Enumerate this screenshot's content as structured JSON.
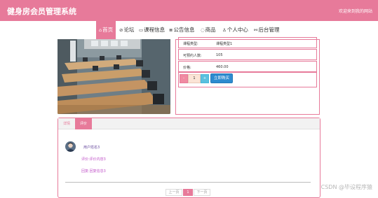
{
  "header": {
    "title": "健身房会员管理系统",
    "welcome": "欢迎来到我的网站"
  },
  "nav": {
    "items": [
      {
        "label": "首页",
        "icon": "home-icon",
        "glyph": "⌂"
      },
      {
        "label": "论坛",
        "icon": "forum-icon",
        "glyph": "⊘"
      },
      {
        "label": "课程信息",
        "icon": "course-icon",
        "glyph": "▭"
      },
      {
        "label": "公告信息",
        "icon": "notice-icon",
        "glyph": "≣"
      },
      {
        "label": "商品",
        "icon": "goods-icon",
        "glyph": "◌"
      },
      {
        "label": "个人中心",
        "icon": "user-icon",
        "glyph": "♙"
      },
      {
        "label": "后台管理",
        "icon": "link-icon",
        "glyph": "⚯"
      }
    ]
  },
  "course": {
    "rows": [
      {
        "label": "课程类型:",
        "value": "课程类型1"
      },
      {
        "label": "可预约人数:",
        "value": "105"
      },
      {
        "label": "价格:",
        "value": "460.00"
      }
    ],
    "quantity": "1",
    "minus_label": "-",
    "plus_label": "+",
    "buy_label": "立即购买"
  },
  "tabs": {
    "detail": "详情",
    "comment": "评价"
  },
  "comment": {
    "user": "用户姓名3",
    "content": "评价:评价内容3",
    "reply": "回复:回复信息3"
  },
  "pagination": {
    "prev": "上一页",
    "current": "1",
    "next": "下一页"
  },
  "watermark": "CSDN @毕设程序猿",
  "colors": {
    "brand": "#e77a9a",
    "buy_button": "#2e8bcf",
    "plus_button": "#5bc0de"
  }
}
